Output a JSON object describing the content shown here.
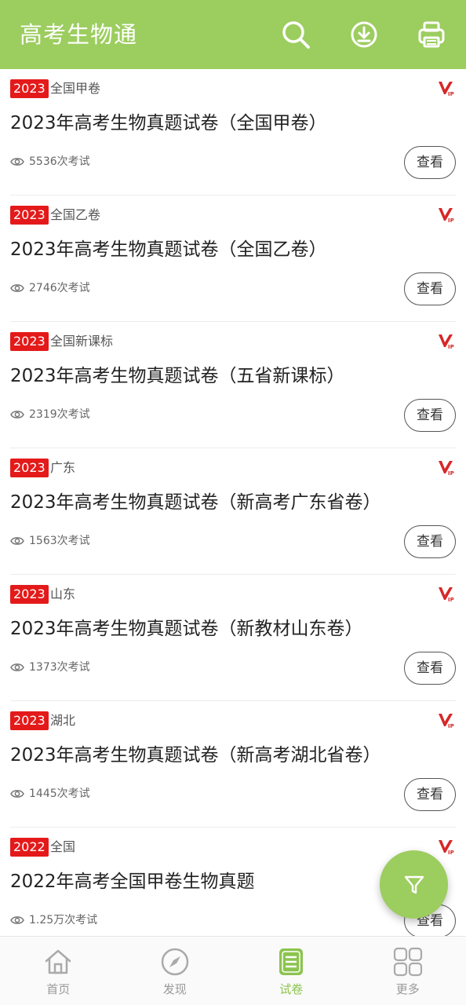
{
  "app": {
    "title": "高考生物通"
  },
  "theme": {
    "primary": "#9ccd5f",
    "badge": "#e41a1a",
    "vip": "#d62828"
  },
  "header_icons": [
    "search-icon",
    "download-icon",
    "print-icon"
  ],
  "papers": [
    {
      "year": "2023",
      "region": "全国甲卷",
      "title": "2023年高考生物真题试卷（全国甲卷）",
      "views": "5536次考试",
      "button": "查看",
      "vip": true
    },
    {
      "year": "2023",
      "region": "全国乙卷",
      "title": "2023年高考生物真题试卷（全国乙卷）",
      "views": "2746次考试",
      "button": "查看",
      "vip": true
    },
    {
      "year": "2023",
      "region": "全国新课标",
      "title": "2023年高考生物真题试卷（五省新课标）",
      "views": "2319次考试",
      "button": "查看",
      "vip": true
    },
    {
      "year": "2023",
      "region": "广东",
      "title": "2023年高考生物真题试卷（新高考广东省卷）",
      "views": "1563次考试",
      "button": "查看",
      "vip": true
    },
    {
      "year": "2023",
      "region": "山东",
      "title": "2023年高考生物真题试卷（新教材山东卷）",
      "views": "1373次考试",
      "button": "查看",
      "vip": true
    },
    {
      "year": "2023",
      "region": "湖北",
      "title": "2023年高考生物真题试卷（新高考湖北省卷）",
      "views": "1445次考试",
      "button": "查看",
      "vip": true
    },
    {
      "year": "2022",
      "region": "全国",
      "title": "2022年高考全国甲卷生物真题",
      "views": "1.25万次考试",
      "button": "查看",
      "vip": true
    }
  ],
  "fab": {
    "icon": "filter-icon"
  },
  "nav": [
    {
      "label": "首页",
      "icon": "home-icon",
      "active": false
    },
    {
      "label": "发现",
      "icon": "compass-icon",
      "active": false
    },
    {
      "label": "试卷",
      "icon": "paper-icon",
      "active": true
    },
    {
      "label": "更多",
      "icon": "grid-icon",
      "active": false
    }
  ]
}
